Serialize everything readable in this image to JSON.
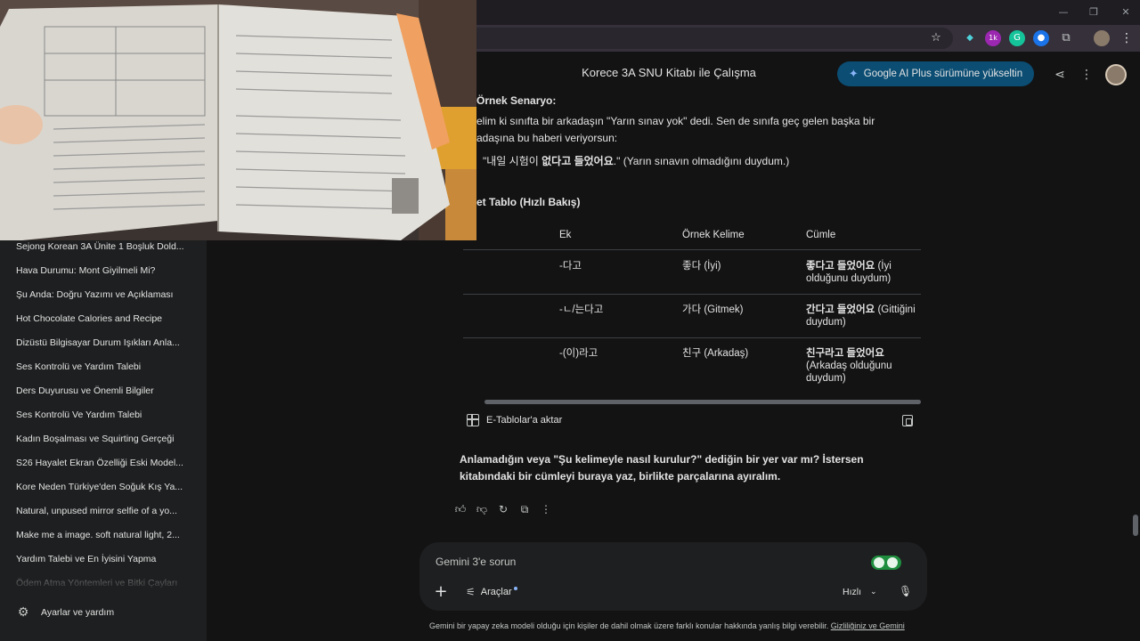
{
  "window": {
    "minimize": "—",
    "restore": "❐",
    "close": "✕"
  },
  "toolbar": {
    "star_icon": "star-icon",
    "extension_badge": "1k",
    "menu_glyph": "⋮"
  },
  "appbar": {
    "title": "Korece 3A SNU Kitabı ile Çalışma",
    "upgrade_label": "Google AI Plus sürümüne yükseltin"
  },
  "sidebar": {
    "items": [
      {
        "label": "Sejong Korean 3A Ünite 1 Boşluk Dold..."
      },
      {
        "label": "Hava Durumu: Mont Giyilmeli Mi?"
      },
      {
        "label": "Şu Anda: Doğru Yazımı ve Açıklaması"
      },
      {
        "label": "Hot Chocolate Calories and Recipe"
      },
      {
        "label": "Dizüstü Bilgisayar Durum Işıkları Anla..."
      },
      {
        "label": "Ses Kontrolü ve Yardım Talebi"
      },
      {
        "label": "Ders Duyurusu ve Önemli Bilgiler"
      },
      {
        "label": "Ses Kontrolü Ve Yardım Talebi"
      },
      {
        "label": "Kadın Boşalması ve Squirting Gerçeği"
      },
      {
        "label": "S26 Hayalet Ekran Özelliği Eski Model..."
      },
      {
        "label": "Kore Neden Türkiye'den Soğuk Kış Ya..."
      },
      {
        "label": "Natural, unpused mirror selfie of a yo..."
      },
      {
        "label": "Make me a image. soft natural light, 2..."
      },
      {
        "label": "Yardım Talebi ve En İyisini Yapma"
      },
      {
        "label": "Ödem Atma Yöntemleri ve Bitki Çayları"
      }
    ],
    "settings_label": "Ayarlar ve yardım"
  },
  "content": {
    "scenario_heading": "Örnek Senaryo:",
    "scenario_line1": "elim ki sınıfta bir arkadaşın \"Yarın sınav yok\" dedi. Sen de sınıfa geç gelen başka bir",
    "scenario_line2": "adaşına bu haberi veriyorsun:",
    "example_pre": "\"내일 시험이 ",
    "example_bold": "없다고 들었어요",
    "example_post": ".\" (Yarın sınavın olmadığını duydum.)",
    "table_heading": "et Tablo (Hızlı Bakış)",
    "table": {
      "headers": [
        "Ek",
        "Örnek Kelime",
        "Cümle"
      ],
      "rows": [
        {
          "ek": "-다고",
          "word": "좋다 (İyi)",
          "sentence_bold": "좋다고 들었어요",
          "sentence_rest": " (İyi olduğunu duydum)"
        },
        {
          "ek": "-ㄴ/는다고",
          "word": "가다 (Gitmek)",
          "sentence_bold": "간다고 들었어요",
          "sentence_rest": " (Gittiğini duydum)"
        },
        {
          "ek": "-(이)라고",
          "word": "친구 (Arkadaş)",
          "sentence_bold": "친구라고 들었어요",
          "sentence_rest": " (Arkadaş olduğunu duydum)"
        }
      ]
    },
    "export_label": "E-Tablolar'a aktar",
    "closing_line1": "Anlamadığın veya \"Şu kelimeyle nasıl kurulur?\" dediğin bir yer var mı? İstersen",
    "closing_line2": "kitabındaki bir cümleyi buraya yaz, birlikte parçalarına ayıralım."
  },
  "input": {
    "placeholder": "Gemini 3'e sorun",
    "tools_label": "Araçlar",
    "speed_label": "Hızlı"
  },
  "disclaimer": {
    "text": "Gemini bir yapay zeka modeli olduğu için kişiler de dahil olmak üzere farklı konular hakkında yanlış bilgi verebilir. ",
    "link": "Gizliliğiniz ve Gemini"
  },
  "colors": {
    "background": "#131314",
    "sidebar": "#1e1f20",
    "upgrade_button": "#0b4d73",
    "accent_blue": "#8ab4f8"
  }
}
